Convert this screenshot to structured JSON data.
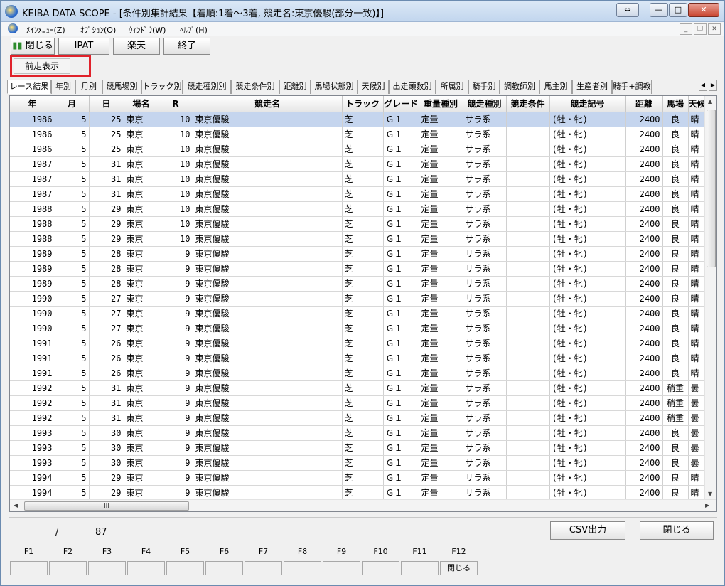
{
  "window": {
    "title": "KEIBA DATA SCOPE - [条件別集計結果【着順:1着～3着, 競走名:東京優駿(部分一致)】]",
    "controls": {
      "restore": "⇔",
      "minimize": "—",
      "maximize": "□",
      "close": "✕"
    }
  },
  "menu": {
    "items": [
      "ﾒｲﾝﾒﾆｭｰ(Z)",
      "ｵﾌﾟｼｮﾝ(O)",
      "ｳｨﾝﾄﾞｳ(W)",
      "ﾍﾙﾌﾟ(H)"
    ],
    "mdi": {
      "minimize": "_",
      "restore": "❐",
      "close": "✕"
    }
  },
  "toolbar": {
    "close_label": "閉じる",
    "ipat_label": "IPAT",
    "rakuten_label": "楽天",
    "exit_label": "終了"
  },
  "prev_button": "前走表示",
  "tabs": [
    "レース結果",
    "年別",
    "月別",
    "競馬場別",
    "トラック別",
    "競走種別別",
    "競走条件別",
    "距離別",
    "馬場状態別",
    "天候別",
    "出走頭数別",
    "所属別",
    "騎手別",
    "調教師別",
    "馬主別",
    "生産者別",
    "騎手+調教"
  ],
  "table": {
    "columns": [
      "年",
      "月",
      "日",
      "場名",
      "R",
      "競走名",
      "トラック",
      "グレード",
      "重量種別",
      "競走種別",
      "競走条件",
      "競走記号",
      "距離",
      "馬場",
      "天候"
    ],
    "rows": [
      [
        "1986",
        "5",
        "25",
        "東京",
        "10",
        "東京優駿",
        "芝",
        "Ｇ１",
        "定量",
        "サラ系",
        "",
        "(牡・牝)",
        "2400",
        "良",
        "晴"
      ],
      [
        "1986",
        "5",
        "25",
        "東京",
        "10",
        "東京優駿",
        "芝",
        "Ｇ１",
        "定量",
        "サラ系",
        "",
        "(牡・牝)",
        "2400",
        "良",
        "晴"
      ],
      [
        "1986",
        "5",
        "25",
        "東京",
        "10",
        "東京優駿",
        "芝",
        "Ｇ１",
        "定量",
        "サラ系",
        "",
        "(牡・牝)",
        "2400",
        "良",
        "晴"
      ],
      [
        "1987",
        "5",
        "31",
        "東京",
        "10",
        "東京優駿",
        "芝",
        "Ｇ１",
        "定量",
        "サラ系",
        "",
        "(牡・牝)",
        "2400",
        "良",
        "晴"
      ],
      [
        "1987",
        "5",
        "31",
        "東京",
        "10",
        "東京優駿",
        "芝",
        "Ｇ１",
        "定量",
        "サラ系",
        "",
        "(牡・牝)",
        "2400",
        "良",
        "晴"
      ],
      [
        "1987",
        "5",
        "31",
        "東京",
        "10",
        "東京優駿",
        "芝",
        "Ｇ１",
        "定量",
        "サラ系",
        "",
        "(牡・牝)",
        "2400",
        "良",
        "晴"
      ],
      [
        "1988",
        "5",
        "29",
        "東京",
        "10",
        "東京優駿",
        "芝",
        "Ｇ１",
        "定量",
        "サラ系",
        "",
        "(牡・牝)",
        "2400",
        "良",
        "晴"
      ],
      [
        "1988",
        "5",
        "29",
        "東京",
        "10",
        "東京優駿",
        "芝",
        "Ｇ１",
        "定量",
        "サラ系",
        "",
        "(牡・牝)",
        "2400",
        "良",
        "晴"
      ],
      [
        "1988",
        "5",
        "29",
        "東京",
        "10",
        "東京優駿",
        "芝",
        "Ｇ１",
        "定量",
        "サラ系",
        "",
        "(牡・牝)",
        "2400",
        "良",
        "晴"
      ],
      [
        "1989",
        "5",
        "28",
        "東京",
        "9",
        "東京優駿",
        "芝",
        "Ｇ１",
        "定量",
        "サラ系",
        "",
        "(牡・牝)",
        "2400",
        "良",
        "晴"
      ],
      [
        "1989",
        "5",
        "28",
        "東京",
        "9",
        "東京優駿",
        "芝",
        "Ｇ１",
        "定量",
        "サラ系",
        "",
        "(牡・牝)",
        "2400",
        "良",
        "晴"
      ],
      [
        "1989",
        "5",
        "28",
        "東京",
        "9",
        "東京優駿",
        "芝",
        "Ｇ１",
        "定量",
        "サラ系",
        "",
        "(牡・牝)",
        "2400",
        "良",
        "晴"
      ],
      [
        "1990",
        "5",
        "27",
        "東京",
        "9",
        "東京優駿",
        "芝",
        "Ｇ１",
        "定量",
        "サラ系",
        "",
        "(牡・牝)",
        "2400",
        "良",
        "晴"
      ],
      [
        "1990",
        "5",
        "27",
        "東京",
        "9",
        "東京優駿",
        "芝",
        "Ｇ１",
        "定量",
        "サラ系",
        "",
        "(牡・牝)",
        "2400",
        "良",
        "晴"
      ],
      [
        "1990",
        "5",
        "27",
        "東京",
        "9",
        "東京優駿",
        "芝",
        "Ｇ１",
        "定量",
        "サラ系",
        "",
        "(牡・牝)",
        "2400",
        "良",
        "晴"
      ],
      [
        "1991",
        "5",
        "26",
        "東京",
        "9",
        "東京優駿",
        "芝",
        "Ｇ１",
        "定量",
        "サラ系",
        "",
        "(牡・牝)",
        "2400",
        "良",
        "晴"
      ],
      [
        "1991",
        "5",
        "26",
        "東京",
        "9",
        "東京優駿",
        "芝",
        "Ｇ１",
        "定量",
        "サラ系",
        "",
        "(牡・牝)",
        "2400",
        "良",
        "晴"
      ],
      [
        "1991",
        "5",
        "26",
        "東京",
        "9",
        "東京優駿",
        "芝",
        "Ｇ１",
        "定量",
        "サラ系",
        "",
        "(牡・牝)",
        "2400",
        "良",
        "晴"
      ],
      [
        "1992",
        "5",
        "31",
        "東京",
        "9",
        "東京優駿",
        "芝",
        "Ｇ１",
        "定量",
        "サラ系",
        "",
        "(牡・牝)",
        "2400",
        "稍重",
        "曇"
      ],
      [
        "1992",
        "5",
        "31",
        "東京",
        "9",
        "東京優駿",
        "芝",
        "Ｇ１",
        "定量",
        "サラ系",
        "",
        "(牡・牝)",
        "2400",
        "稍重",
        "曇"
      ],
      [
        "1992",
        "5",
        "31",
        "東京",
        "9",
        "東京優駿",
        "芝",
        "Ｇ１",
        "定量",
        "サラ系",
        "",
        "(牡・牝)",
        "2400",
        "稍重",
        "曇"
      ],
      [
        "1993",
        "5",
        "30",
        "東京",
        "9",
        "東京優駿",
        "芝",
        "Ｇ１",
        "定量",
        "サラ系",
        "",
        "(牡・牝)",
        "2400",
        "良",
        "曇"
      ],
      [
        "1993",
        "5",
        "30",
        "東京",
        "9",
        "東京優駿",
        "芝",
        "Ｇ１",
        "定量",
        "サラ系",
        "",
        "(牡・牝)",
        "2400",
        "良",
        "曇"
      ],
      [
        "1993",
        "5",
        "30",
        "東京",
        "9",
        "東京優駿",
        "芝",
        "Ｇ１",
        "定量",
        "サラ系",
        "",
        "(牡・牝)",
        "2400",
        "良",
        "曇"
      ],
      [
        "1994",
        "5",
        "29",
        "東京",
        "9",
        "東京優駿",
        "芝",
        "Ｇ１",
        "定量",
        "サラ系",
        "",
        "(牡・牝)",
        "2400",
        "良",
        "晴"
      ],
      [
        "1994",
        "5",
        "29",
        "東京",
        "9",
        "東京優駿",
        "芝",
        "Ｇ１",
        "定量",
        "サラ系",
        "",
        "(牡・牝)",
        "2400",
        "良",
        "晴"
      ]
    ]
  },
  "status": {
    "slash": "/",
    "count": "87"
  },
  "footer": {
    "csv_label": "CSV出力",
    "close_label": "閉じる"
  },
  "fkeys": [
    {
      "key": "F1",
      "label": ""
    },
    {
      "key": "F2",
      "label": ""
    },
    {
      "key": "F3",
      "label": ""
    },
    {
      "key": "F4",
      "label": ""
    },
    {
      "key": "F5",
      "label": ""
    },
    {
      "key": "F6",
      "label": ""
    },
    {
      "key": "F7",
      "label": ""
    },
    {
      "key": "F8",
      "label": ""
    },
    {
      "key": "F9",
      "label": ""
    },
    {
      "key": "F10",
      "label": ""
    },
    {
      "key": "F11",
      "label": ""
    },
    {
      "key": "F12",
      "label": "閉じる"
    }
  ],
  "colors": {
    "selected_row": "#c5d5ee",
    "highlight_box": "#e0222b"
  }
}
